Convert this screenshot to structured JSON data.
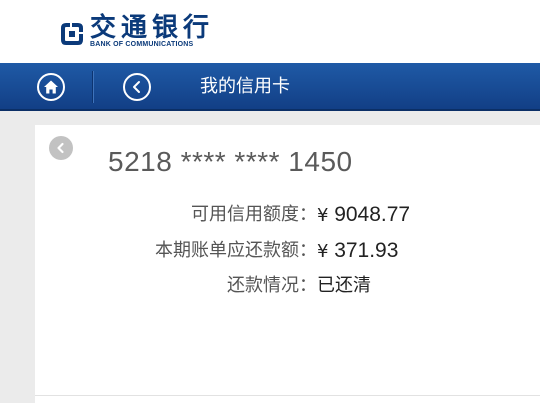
{
  "header": {
    "logo_cn": "交通银行",
    "logo_en": "BANK OF COMMUNICATIONS",
    "brand_color": "#0b3a7a"
  },
  "navbar": {
    "title": "我的信用卡",
    "home_icon": "home-icon",
    "back_icon": "back-icon",
    "bar_color": "#1f5aa6"
  },
  "card": {
    "number": "5218 **** **** 1450",
    "back_icon": "back-icon",
    "rows": [
      {
        "label": "可用信用额度：",
        "currency": "¥",
        "value": "9048.77"
      },
      {
        "label": "本期账单应还款额：",
        "currency": "¥",
        "value": "371.93"
      },
      {
        "label": "还款情况：",
        "value": "已还清"
      }
    ]
  }
}
